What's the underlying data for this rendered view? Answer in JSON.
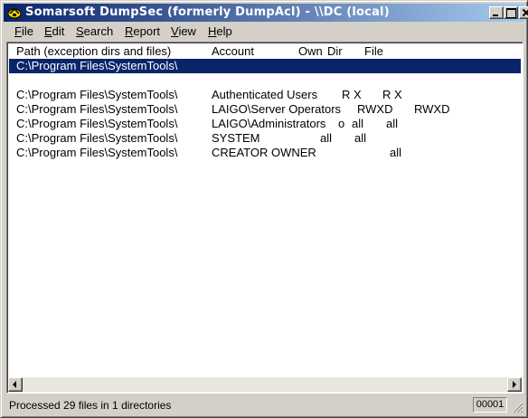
{
  "window": {
    "title": "Somarsoft DumpSec (formerly DumpAcl) - \\\\DC (local)",
    "title_bar_color": "#0a246a"
  },
  "menu": [
    {
      "label": "File",
      "accel": "F",
      "rest": "ile"
    },
    {
      "label": "Edit",
      "accel": "E",
      "rest": "dit"
    },
    {
      "label": "Search",
      "accel": "S",
      "rest": "earch"
    },
    {
      "label": "Report",
      "accel": "R",
      "rest": "eport"
    },
    {
      "label": "View",
      "accel": "V",
      "rest": "iew"
    },
    {
      "label": "Help",
      "accel": "H",
      "rest": "elp"
    }
  ],
  "list": {
    "headers": {
      "path": "Path (exception dirs and files)",
      "account": "Account",
      "own": "Own",
      "dir": "Dir",
      "file": "File"
    },
    "selected_row": "C:\\Program Files\\SystemTools\\",
    "rows": [
      {
        "path": "C:\\Program Files\\SystemTools\\",
        "account": "Authenticated Users",
        "own": "",
        "dir": "R X",
        "file": "R X"
      },
      {
        "path": "C:\\Program Files\\SystemTools\\",
        "account": "LAIGO\\Server Operators",
        "own": "",
        "dir": "RWXD",
        "file": "RWXD"
      },
      {
        "path": "C:\\Program Files\\SystemTools\\",
        "account": "LAIGO\\Administrators",
        "own": "o",
        "dir": "all",
        "file": "all"
      },
      {
        "path": "C:\\Program Files\\SystemTools\\",
        "account": "SYSTEM",
        "own": "",
        "dir": "all",
        "file": "all"
      },
      {
        "path": "C:\\Program Files\\SystemTools\\",
        "account": "CREATOR OWNER",
        "own": "",
        "dir": "",
        "file": "all"
      }
    ]
  },
  "status": {
    "text": "Processed 29 files in 1 directories",
    "count": "00001"
  }
}
